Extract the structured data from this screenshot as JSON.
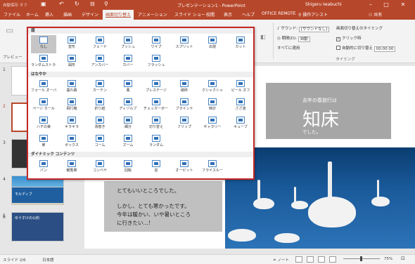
{
  "titlebar": {
    "autosave": "自動保存",
    "autosave_state": "オフ",
    "title": "プレゼンテーション1 - PowerPoint",
    "user": "Shigeru Iwabuchi"
  },
  "tabs": [
    {
      "label": "ファイル"
    },
    {
      "label": "ホーム"
    },
    {
      "label": "挿入"
    },
    {
      "label": "描画"
    },
    {
      "label": "デザイン"
    },
    {
      "label": "画面切り替え",
      "active": true
    },
    {
      "label": "アニメーション"
    },
    {
      "label": "スライド ショー"
    },
    {
      "label": "校閲"
    },
    {
      "label": "表示"
    },
    {
      "label": "ヘルプ"
    },
    {
      "label": "OFFICE REMOTE"
    }
  ],
  "tell_me": "操作アシスト",
  "share": "共有",
  "ribbon": {
    "preview_label": "プレビュー",
    "sound_label": "サウンド:",
    "sound_value": "[サウンドなし]",
    "duration_label": "期間(D):",
    "duration_value": "自動",
    "apply_all": "すべてに適用",
    "advance_title": "画面切り替えのタイミング",
    "on_click": "クリック時",
    "after_label": "自動的に切り替え",
    "after_value": "00:00.00",
    "group_label": "タイミング"
  },
  "gallery": {
    "sections": [
      {
        "title": "弱",
        "items": [
          "なし",
          "変形",
          "フェード",
          "プッシュ",
          "ワイプ",
          "スプリット",
          "出現",
          "カット",
          "ランダムストライプ",
          "図形",
          "アンカバー",
          "カバー",
          "フラッシュ"
        ]
      },
      {
        "title": "はなやか",
        "items": [
          "フォール オーバー",
          "垂れ幕",
          "カーテン",
          "風",
          "プレステージ",
          "破砕",
          "クシャクシャ",
          "ピール オフ",
          "ページ カール",
          "飛行機",
          "折り紙",
          "ディゾルブ",
          "チェッカーボード",
          "ブラインド",
          "時計",
          "さざ波",
          "ハチの巣",
          "キラキラ",
          "渦巻き",
          "細分",
          "切り替え",
          "フリップ",
          "ギャラリー",
          "キューブ",
          "扉",
          "ボックス",
          "コーム",
          "ズーム",
          "ランダム"
        ]
      },
      {
        "title": "ダイナミック コンテンツ",
        "items": [
          "パン",
          "観覧車",
          "コンベヤ",
          "回転",
          "窓",
          "オービット",
          "フライスルー"
        ]
      }
    ]
  },
  "thumbnails": [
    {
      "num": "1",
      "text": ""
    },
    {
      "num": "2",
      "text": ""
    },
    {
      "num": "3",
      "text": ""
    },
    {
      "num": "4",
      "text": ""
    },
    {
      "num": "5",
      "text": "モルディブ"
    },
    {
      "num": "6",
      "text": "ゆうすけの公約"
    }
  ],
  "slide": {
    "title_small": "去年の春旅行は",
    "title_big": "知床",
    "title_sub": "でした。",
    "body_lines": [
      "とてもいいところでした。",
      "",
      "しかし、とても寒かったです。",
      "今年は暖かい、いや暑いところ",
      "に行きたい…!"
    ]
  },
  "statusbar": {
    "slide_count": "スライド 2/6",
    "language": "日本語",
    "notes": "ノート",
    "zoom": "75%"
  },
  "colors": {
    "accent": "#b7472a",
    "gallery_border": "#c62828",
    "icon_blue": "#2f6fb6"
  }
}
